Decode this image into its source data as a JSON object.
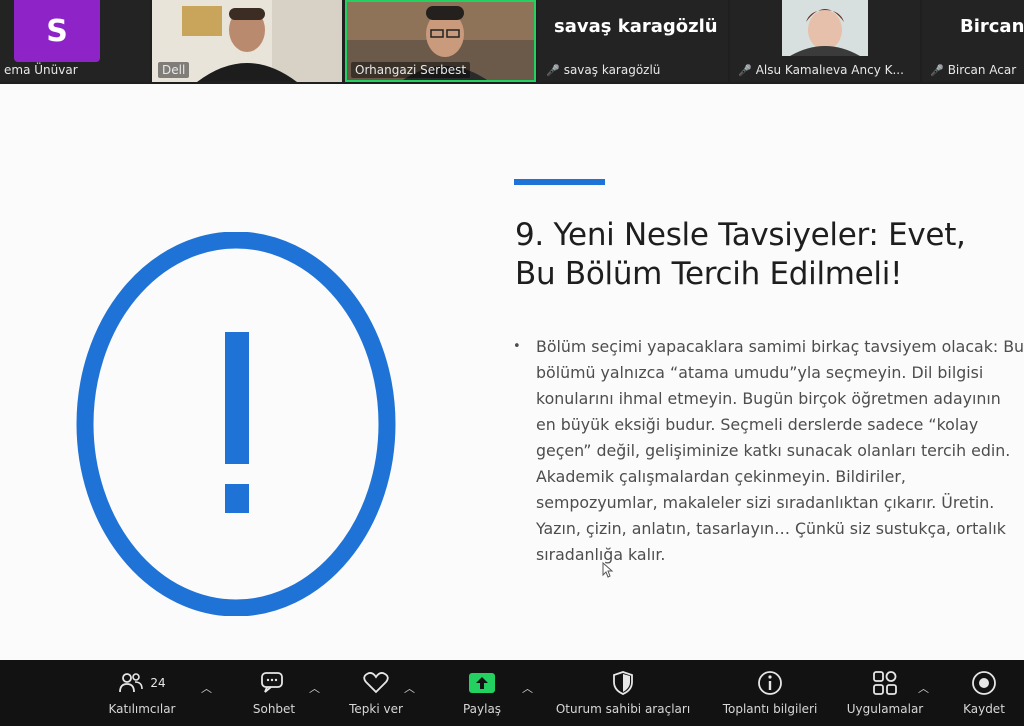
{
  "participants": [
    {
      "initial": "S",
      "name": "ema Ünüvar"
    },
    {
      "name": "Dell"
    },
    {
      "name": "Orhangazi Serbest"
    },
    {
      "display_name": "savaş karagözlü",
      "name": "savaş karagözlü"
    },
    {
      "name": "Alsu Kamalıeva Ancy K..."
    },
    {
      "display_name": "Bircan",
      "name": "Bircan Acar"
    }
  ],
  "slide": {
    "title": "9. Yeni Nesle Tavsiyeler: Evet, Bu Bölüm Tercih Edilmeli!",
    "bullet": "Bölüm seçimi yapacaklara samimi birkaç tavsiyem olacak: Bu bölümü yalnızca “atama umudu”yla seçmeyin. Dil bilgisi konularını ihmal etmeyin. Bugün birçok öğretmen adayının en büyük eksiği budur. Seçmeli derslerde sadece “kolay geçen” değil, gelişiminize katkı sunacak olanları tercih edin. Akademik çalışmalardan çekinmeyin. Bildiriler, sempozyumlar, makaleler sizi sıradanlıktan çıkarır. Üretin. Yazın, çizin, anlatın, tasarlayın… Çünkü siz sustukça, ortalık sıradanlığa kalır.",
    "accent_color": "#1f73d6"
  },
  "toolbar": {
    "participants_label": "Katılımcılar",
    "participants_count": "24",
    "chat_label": "Sohbet",
    "reactions_label": "Tepki ver",
    "share_label": "Paylaş",
    "host_tools_label": "Oturum sahibi araçları",
    "meeting_info_label": "Toplantı bilgileri",
    "apps_label": "Uygulamalar",
    "record_label": "Kaydet",
    "share_color": "#23d160"
  }
}
